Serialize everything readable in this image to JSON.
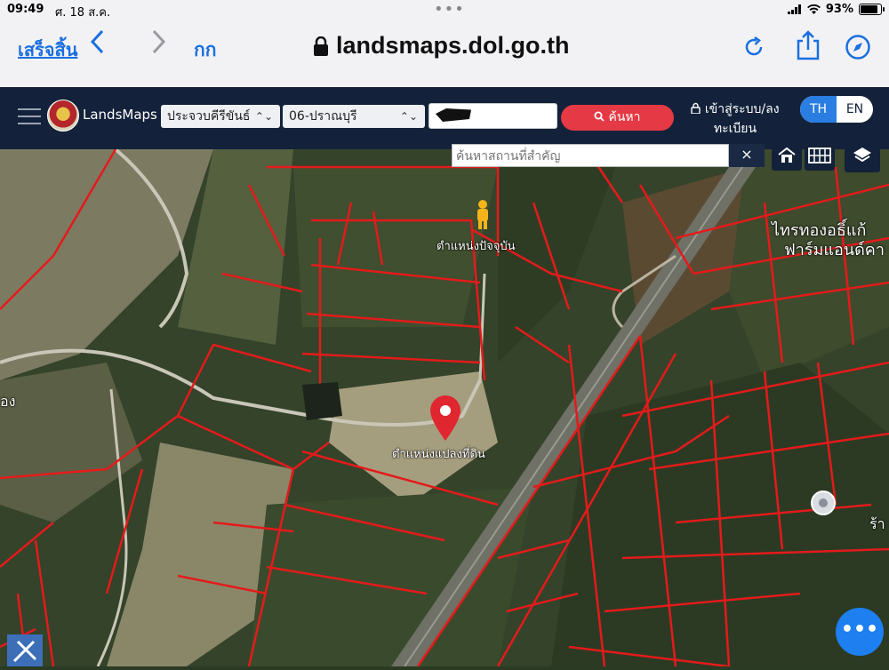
{
  "status_bar": {
    "time": "09:49",
    "date": "ศ. 18 ส.ค.",
    "battery": "93%",
    "battery_level": 0.93
  },
  "browser": {
    "done_label": "เสร็จสิ้น",
    "text_size_label": "กก",
    "url": "landsmaps.dol.go.th",
    "back_icon": "chevron-left-icon",
    "forward_icon": "chevron-right-icon",
    "reload_icon": "reload-icon",
    "share_icon": "share-icon",
    "compass_icon": "compass-icon"
  },
  "header": {
    "brand": "LandsMaps",
    "province": "ประจวบคีรีขันธ์",
    "district": "06-ปราณบุรี",
    "search_value": "",
    "search_button": "ค้นหา",
    "login_line1": "เข้าสู่ระบบ/ลง",
    "login_line2": "ทะเบียน",
    "lang_th": "TH",
    "lang_en": "EN"
  },
  "map": {
    "place_search_placeholder": "ค้นหาสถานที่สำคัญ",
    "place_close": "×",
    "current_location_label": "ตำแหน่งปัจจุบัน",
    "parcel_location_label": "ตำแหน่งแปลงที่ดิน",
    "poi_label_1": "ไทรทองอธิ์แก้",
    "poi_label_2": "ฟาร์มแอนด์คา",
    "edge_label_left": "อง",
    "edge_label_right": "ร้า",
    "fab_label": "•••",
    "colors": {
      "parcel_line": "#e31b1b",
      "pin": "#e0262f",
      "fab": "#1d7ff0",
      "header": "#13223a"
    }
  }
}
